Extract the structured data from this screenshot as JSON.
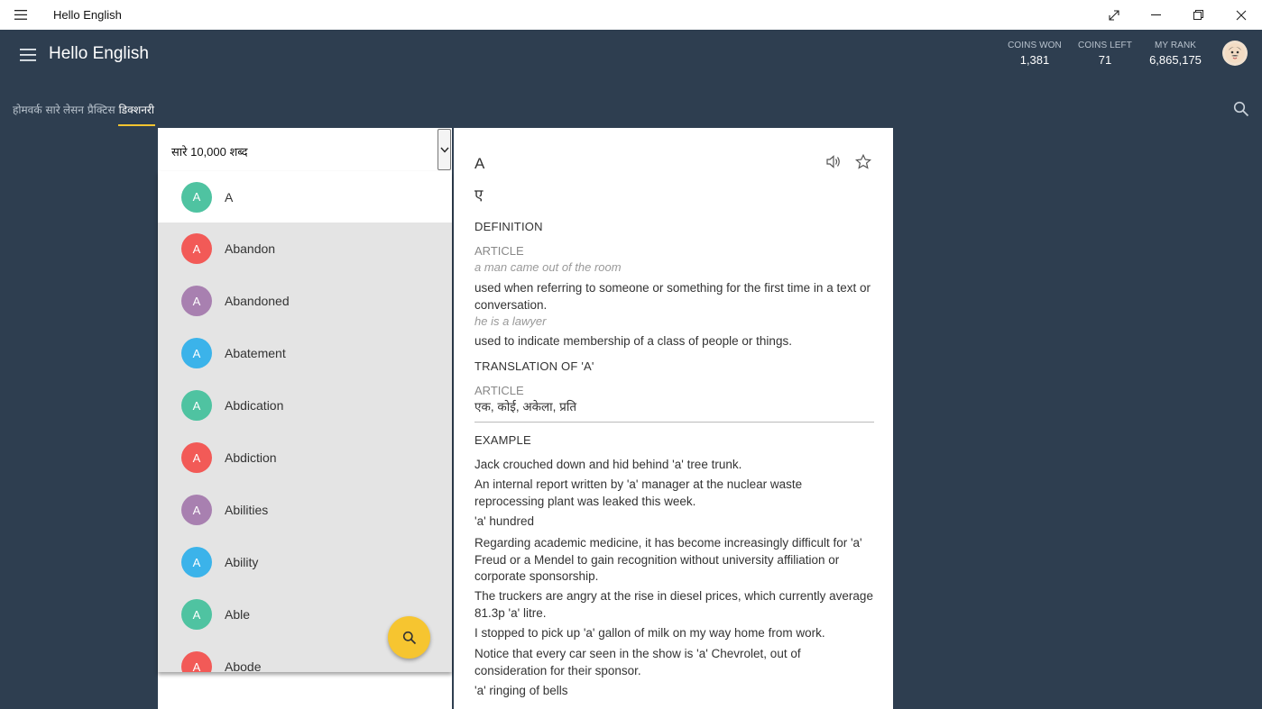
{
  "window": {
    "title": "Hello English",
    "buttons": [
      "fullscreen",
      "minimize",
      "restore",
      "close"
    ]
  },
  "header": {
    "title": "Hello English",
    "stats": [
      {
        "label": "COINS WON",
        "value": "1,381"
      },
      {
        "label": "COINS LEFT",
        "value": "71"
      },
      {
        "label": "MY RANK",
        "value": "6,865,175"
      }
    ],
    "tabs": [
      {
        "label": "होमवर्क"
      },
      {
        "label": "सारे लेसन"
      },
      {
        "label": "प्रैक्टिस"
      },
      {
        "label": "डिक्शनरी"
      }
    ],
    "active_tab": 3
  },
  "word_list": {
    "filter_label": "सारे 10,000 शब्द",
    "items": [
      {
        "initial": "A",
        "word": "A",
        "color": "#4fc3a1"
      },
      {
        "initial": "A",
        "word": "Abandon",
        "color": "#f25a57"
      },
      {
        "initial": "A",
        "word": "Abandoned",
        "color": "#a880b0"
      },
      {
        "initial": "A",
        "word": "Abatement",
        "color": "#3bb3ea"
      },
      {
        "initial": "A",
        "word": "Abdication",
        "color": "#4fc3a1"
      },
      {
        "initial": "A",
        "word": "Abdiction",
        "color": "#f25a57"
      },
      {
        "initial": "A",
        "word": "Abilities",
        "color": "#a880b0"
      },
      {
        "initial": "A",
        "word": "Ability",
        "color": "#3bb3ea"
      },
      {
        "initial": "A",
        "word": "Able",
        "color": "#4fc3a1"
      },
      {
        "initial": "A",
        "word": "Abode",
        "color": "#f25a57"
      }
    ],
    "selected_index": 0
  },
  "detail": {
    "word": "A",
    "hindi": "ए",
    "definition_heading": "DEFINITION",
    "pos": "ARTICLE",
    "example1": "a man came out of the room",
    "meaning1": "used when referring to someone or something for the first time in a text or conversation.",
    "example2": "he is a lawyer",
    "meaning2": "used to indicate membership of a class of people or things.",
    "translation_heading": "TRANSLATION OF 'A'",
    "translation_pos": "ARTICLE",
    "translation": "एक, कोई, अकेला, प्रति",
    "example_heading": "EXAMPLE",
    "examples": [
      "Jack crouched down and hid behind 'a' tree trunk.",
      "An internal report written by 'a' manager at the nuclear waste reprocessing plant was leaked this week.",
      "'a' hundred",
      "Regarding academic medicine, it has become increasingly difficult for 'a' Freud or a Mendel to gain recognition without university affiliation or corporate sponsorship.",
      "The truckers are angry at the rise in diesel prices, which currently average 81.3p 'a' litre.",
      "I stopped to pick up 'a' gallon of milk on my way home from work.",
      "Notice that every car seen in the show is 'a' Chevrolet, out of consideration for their sponsor.",
      "'a' ringing of bells"
    ]
  },
  "colors": {
    "header_bg": "#2e3e50",
    "tab_underline": "#f4c430",
    "fab": "#f6c530"
  }
}
